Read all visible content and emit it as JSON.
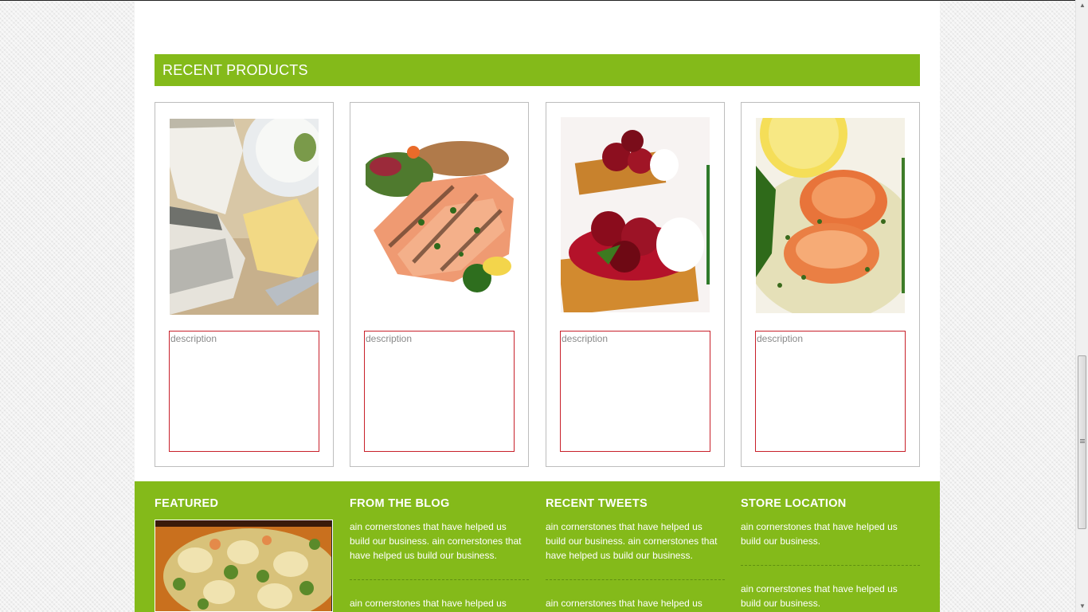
{
  "recent_products": {
    "title": "RECENT PRODUCTS",
    "products": [
      {
        "image": "cheese-plate-photo",
        "description_placeholder": "description"
      },
      {
        "image": "grilled-salmon-photo",
        "description_placeholder": "description"
      },
      {
        "image": "cherry-dessert-photo",
        "description_placeholder": "description"
      },
      {
        "image": "grilled-shrimp-photo",
        "description_placeholder": "description"
      }
    ]
  },
  "footer": {
    "featured": {
      "title": "FEATURED",
      "image": "pasta-salad-photo"
    },
    "blog": {
      "title": "FROM THE BLOG",
      "posts": [
        "ain cornerstones that have helped us build our business. ain cornerstones that have helped us build our business.",
        "ain cornerstones that have helped us"
      ]
    },
    "tweets": {
      "title": "RECENT TWEETS",
      "items": [
        "ain cornerstones that have helped us build our business. ain cornerstones that have helped us build our business.",
        "ain cornerstones that have helped us"
      ]
    },
    "store": {
      "title": "STORE LOCATION",
      "items": [
        "ain cornerstones that have helped us build our business.",
        "ain cornerstones that have helped us build our business."
      ]
    }
  },
  "colors": {
    "accent": "#84ba1a",
    "input_border": "#c8202a",
    "card_border": "#bdbdbd"
  }
}
